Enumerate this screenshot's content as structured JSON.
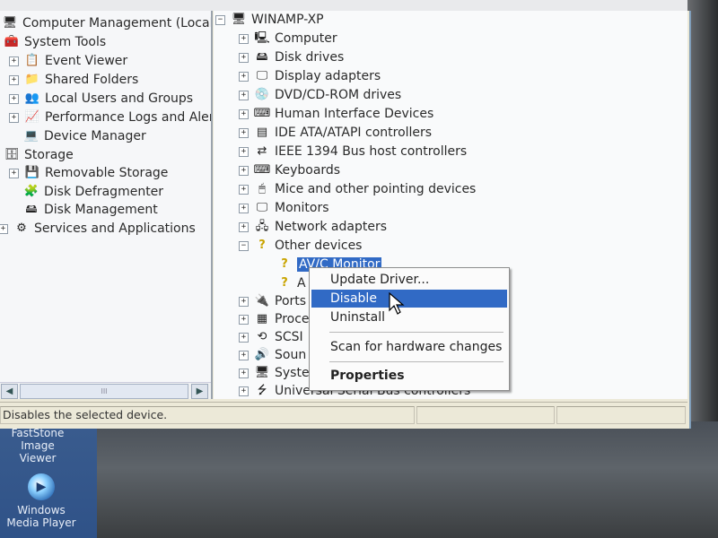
{
  "desktop": {
    "icons": [
      {
        "label_line1": "FastStone",
        "label_line2": "Image Viewer",
        "icon": "faststone-icon"
      },
      {
        "label_line1": "Windows",
        "label_line2": "Media Player",
        "icon": "windows-media-player-icon"
      }
    ]
  },
  "left_tree": {
    "root": "Computer Management (Local)",
    "items": [
      {
        "label": "System Tools",
        "icon": "toolbox-icon"
      },
      {
        "label": "Event Viewer",
        "icon": "event-viewer-icon"
      },
      {
        "label": "Shared Folders",
        "icon": "shared-folders-icon"
      },
      {
        "label": "Local Users and Groups",
        "icon": "users-icon"
      },
      {
        "label": "Performance Logs and Alerts",
        "icon": "performance-icon"
      },
      {
        "label": "Device Manager",
        "icon": "device-manager-icon"
      },
      {
        "label": "Storage",
        "icon": "storage-icon"
      },
      {
        "label": "Removable Storage",
        "icon": "removable-storage-icon"
      },
      {
        "label": "Disk Defragmenter",
        "icon": "defrag-icon"
      },
      {
        "label": "Disk Management",
        "icon": "disk-management-icon"
      },
      {
        "label": "Services and Applications",
        "icon": "services-icon"
      }
    ],
    "scroll_thumb_text": "III"
  },
  "right_tree": {
    "root": "WINAMP-XP",
    "devices": [
      {
        "label": "Computer",
        "icon": "computer-icon"
      },
      {
        "label": "Disk drives",
        "icon": "disk-drive-icon"
      },
      {
        "label": "Display adapters",
        "icon": "display-adapter-icon"
      },
      {
        "label": "DVD/CD-ROM drives",
        "icon": "cdrom-icon"
      },
      {
        "label": "Human Interface Devices",
        "icon": "hid-icon"
      },
      {
        "label": "IDE ATA/ATAPI controllers",
        "icon": "ide-controller-icon"
      },
      {
        "label": "IEEE 1394 Bus host controllers",
        "icon": "firewire-icon"
      },
      {
        "label": "Keyboards",
        "icon": "keyboard-icon"
      },
      {
        "label": "Mice and other pointing devices",
        "icon": "mouse-icon"
      },
      {
        "label": "Monitors",
        "icon": "monitor-icon"
      },
      {
        "label": "Network adapters",
        "icon": "network-adapter-icon"
      },
      {
        "label": "Other devices",
        "icon": "unknown-device-icon"
      }
    ],
    "other_children": [
      {
        "label": "AV/C Monitor",
        "icon": "warning-device-icon"
      },
      {
        "label": "A",
        "icon": "warning-device-icon"
      }
    ],
    "after": [
      {
        "label": "Ports",
        "icon": "ports-icon"
      },
      {
        "label": "Proce",
        "icon": "processor-icon"
      },
      {
        "label": "SCSI",
        "icon": "scsi-icon"
      },
      {
        "label": "Soun",
        "icon": "sound-icon"
      },
      {
        "label": "Syste",
        "icon": "system-devices-icon"
      },
      {
        "label": "Universal Serial Bus controllers",
        "icon": "usb-icon"
      }
    ]
  },
  "context_menu": {
    "items": [
      "Update Driver...",
      "Disable",
      "Uninstall",
      "Scan for hardware changes",
      "Properties"
    ],
    "highlighted": "Disable"
  },
  "status": {
    "text": "Disables the selected device."
  },
  "colors": {
    "selection": "#316ac5",
    "window_bg": "#ece9d8",
    "pane_bg": "#f6f7f9"
  }
}
